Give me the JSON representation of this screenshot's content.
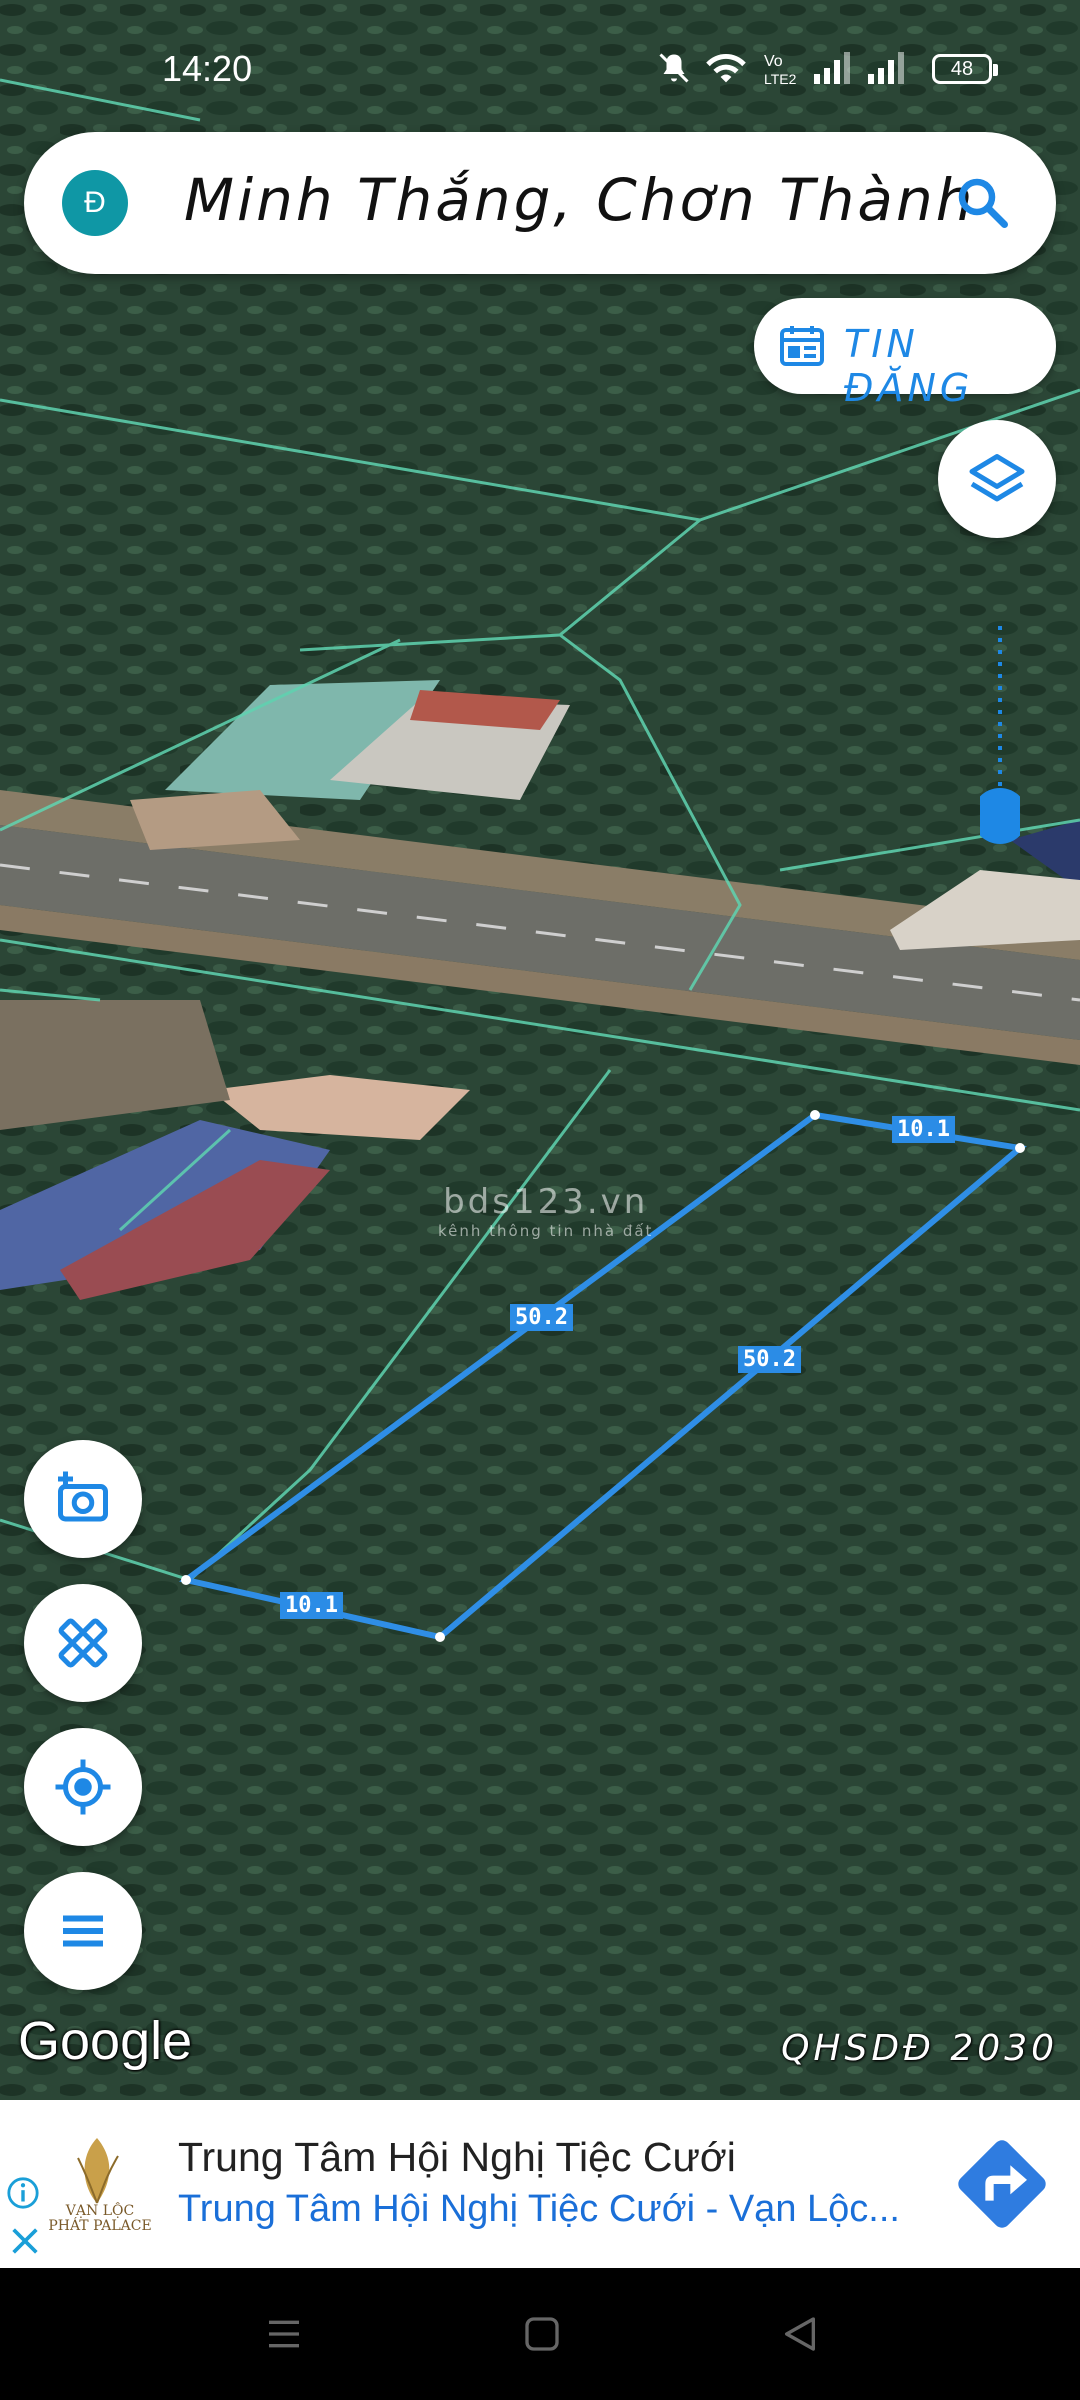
{
  "status_bar": {
    "time": "14:20",
    "battery": "48"
  },
  "search": {
    "avatar_letter": "Đ",
    "query": "Minh Thắng, Chơn Thành"
  },
  "tin_dang": {
    "label": "TIN ĐĂNG"
  },
  "map": {
    "watermark": "bds123.vn",
    "watermark_sub": "kênh thông tin nhà đất",
    "google_logo": "Google",
    "layer_label": "QHSDĐ 2030",
    "measurements": {
      "top": "10.1",
      "left": "50.2",
      "right": "50.2",
      "bottom": "10.1"
    }
  },
  "ad": {
    "logo_text": "VẠN LỘC PHÁT PALACE",
    "title": "Trung Tâm Hội Nghị Tiệc Cưới",
    "subtitle": "Trung Tâm Hội Nghị Tiệc Cưới - Vạn Lộc..."
  },
  "colors": {
    "accent": "#1e88e5",
    "teal": "#0f97a5",
    "plot_line": "#2f8ee6"
  },
  "icons": [
    "search-icon",
    "layers-icon",
    "camera-icon",
    "ruler-icon",
    "locate-icon",
    "menu-icon",
    "directions-icon",
    "info-icon",
    "close-icon"
  ]
}
